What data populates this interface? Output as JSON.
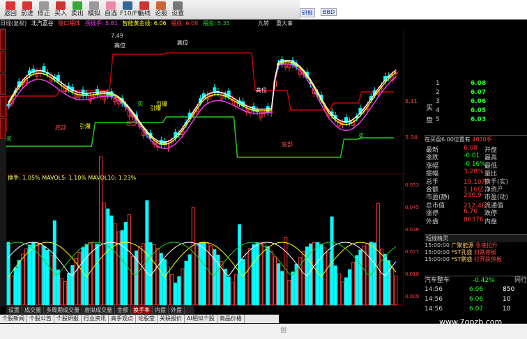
{
  "toolbar": {
    "buttons": [
      "返回",
      "前进",
      "修正",
      "买入",
      "卖出",
      "模拟",
      "自选",
      "F10/F9",
      "画线",
      "论股",
      "设置"
    ],
    "right": [
      "研报",
      "BBD"
    ]
  },
  "ribbon": {
    "period": "日线(复权)",
    "stock": "北汽蓝谷",
    "i1": "隐口福体",
    "i2": "拐线手: 5.81",
    "i3": "智能黄金线: 6.06",
    "i4": "福底: 6.08",
    "i5": "福底: 5.35",
    "r1": "九转",
    "r2": "重大事"
  },
  "chart": {
    "top_label": "7.49",
    "right_high": "6.11",
    "right_low": "5.34",
    "signals": [
      "高位",
      "高位",
      "高位",
      "买",
      "引爆",
      "引爆",
      "底部",
      "引爆",
      "底部",
      "底部",
      "买",
      "买"
    ],
    "vol_header": "换手: 1.05% MAVOL5: 1.10% MAVOL10: 1.23%",
    "vol_ticks": [
      "0.053",
      "0.045",
      "0.036",
      "0.027",
      "0.018",
      "0.009"
    ],
    "center_mark": "创"
  },
  "quote": {
    "sell_rows": [
      {
        "n": "1",
        "p": "6.08"
      },
      {
        "n": "2",
        "p": "6.07"
      },
      {
        "n": "3",
        "p": "6.06"
      },
      {
        "n": "4",
        "p": "6.05"
      },
      {
        "n": "5",
        "p": "6.03"
      }
    ],
    "side_label_1": "买",
    "side_label_2": "盘",
    "summary": "在买盘6.00位置有",
    "summary_vol": "4070手",
    "fields": [
      {
        "k": "最新",
        "v": "6.08",
        "k2": "开盘",
        "v2": ""
      },
      {
        "k": "涨跌",
        "v": "-0.01",
        "k2": "最高",
        "v2": ""
      },
      {
        "k": "涨幅",
        "v": "-0.16%",
        "k2": "最低",
        "v2": ""
      },
      {
        "k": "振幅",
        "v": "3.28%",
        "k2": "量比",
        "v2": ""
      },
      {
        "k": "总手",
        "v": "19.10万",
        "k2": "换手(实)",
        "v2": ""
      },
      {
        "k": "金额",
        "v": "1.16亿",
        "k2": "净资产",
        "v2": ""
      },
      {
        "k": "市盈(静)",
        "v": "230.9",
        "k2": "市盈(动)",
        "v2": ""
      },
      {
        "k": "总市值",
        "v": "212.4亿",
        "k2": "流通值",
        "v2": ""
      },
      {
        "k": "涨停",
        "v": "6.70",
        "k2": "跌停",
        "v2": ""
      },
      {
        "k": "外盘",
        "v": "86376",
        "k2": "内盘",
        "v2": ""
      }
    ]
  },
  "alert": {
    "title": "短线精灵",
    "rows": [
      {
        "t": "15:00:00",
        "n": "广聚能源",
        "s": "急速拉升"
      },
      {
        "t": "15:00:00",
        "n": "*ST孔盛",
        "s": "封跌停板"
      },
      {
        "t": "15:00:00",
        "n": "*ST鹏盛",
        "s": "打开跌停板"
      }
    ]
  },
  "trade": {
    "title": "汽车整车",
    "pct": "-0.42%",
    "right": "同行",
    "rows": [
      {
        "t": "14:56",
        "p": "6.06",
        "v": "850"
      },
      {
        "t": "14:56",
        "p": "6.06",
        "v": "10"
      },
      {
        "t": "14:56",
        "p": "6.07",
        "v": "10"
      }
    ]
  },
  "bottom_tabs": [
    "设置",
    "成交量",
    "多周期成交量",
    "虚拟成交量",
    "金额",
    "换手率",
    "内盘",
    "外盘"
  ],
  "bottom_links": [
    "个股新闻",
    "个股公告",
    "个股研报",
    "行业资讯",
    "高手观点",
    "论股堂",
    "关联报价",
    "AI相似个股",
    "商品价格"
  ],
  "watermark": "www.7gpzb.com",
  "colors": {
    "up": "#ff3333",
    "down": "#00ffff",
    "ma_white": "#ffffff",
    "ma_yellow": "#ffff00",
    "ma_magenta": "#ff33ff",
    "band_red": "#cc0000",
    "band_green": "#22cc22"
  }
}
